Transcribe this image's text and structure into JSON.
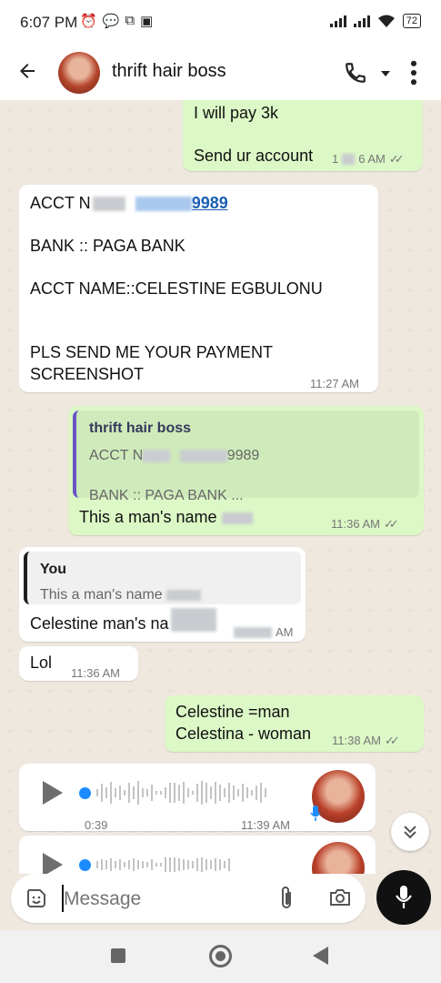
{
  "status_bar": {
    "time": "6:07 PM",
    "battery": "72"
  },
  "header": {
    "contact_name": "thrift hair boss"
  },
  "messages": {
    "m1": {
      "line1": "I will pay 3k",
      "line2": "Send ur account",
      "time_prefix": "1",
      "time_suffix": "6 AM"
    },
    "m2": {
      "acct_prefix": "ACCT N",
      "acct_link_suffix": "9989",
      "bank": "BANK :: PAGA  BANK",
      "acct_name": "ACCT NAME::CELESTINE EGBULONU",
      "pls1": "PLS SEND ME YOUR PAYMENT",
      "pls2": "SCREENSHOT",
      "time": "11:27 AM"
    },
    "m3": {
      "quote_author": "thrift hair boss",
      "quote_line1_prefix": "ACCT N",
      "quote_line1_suffix": "9989",
      "quote_line2": "BANK :: PAGA  BANK ...",
      "text": "This a man's name",
      "time": "11:36 AM"
    },
    "m4": {
      "quote_author": "You",
      "quote_text": "This a man's name",
      "text": "Celestine man's na",
      "time_suffix": "AM"
    },
    "m5": {
      "text": "Lol",
      "time": "11:36 AM"
    },
    "m6": {
      "line1": "Celestine =man",
      "line2": "Celestina - woman",
      "time": "11:38 AM"
    },
    "voice1": {
      "duration": "0:39",
      "time": "11:39 AM"
    }
  },
  "composer": {
    "placeholder": "Message"
  },
  "colors": {
    "outgoing": "#dcf8c6",
    "incoming": "#ffffff",
    "link": "#1a5fb4",
    "mic_button": "#111111"
  },
  "icons": [
    "back-arrow-icon",
    "phone-icon",
    "chevron-down-icon",
    "more-vert-icon",
    "play-icon",
    "mic-icon",
    "sticker-icon",
    "attach-icon",
    "camera-icon",
    "double-check-icon",
    "double-chevron-down-icon"
  ]
}
